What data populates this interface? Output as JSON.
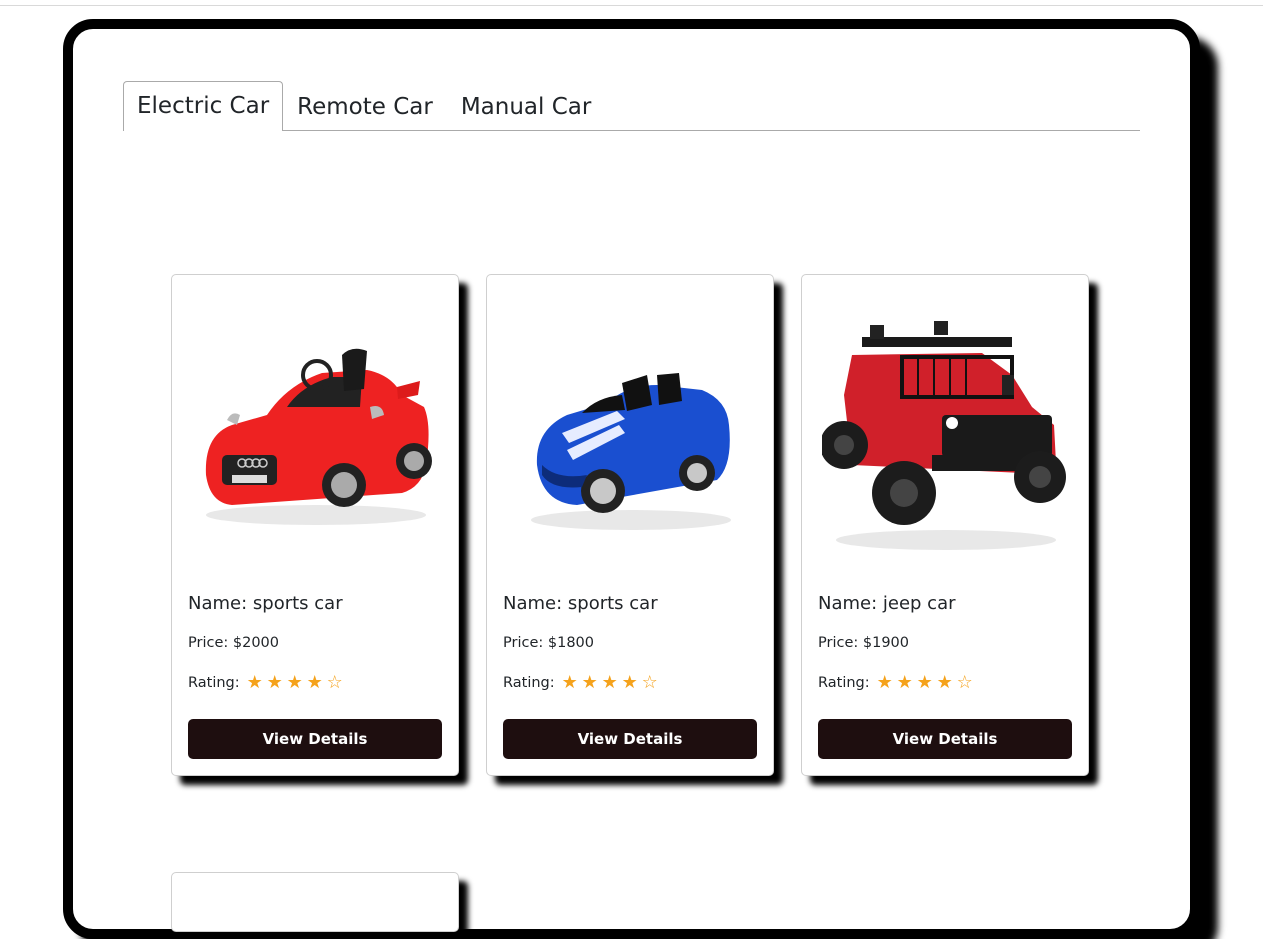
{
  "tabs": [
    {
      "label": "Electric Car",
      "active": true
    },
    {
      "label": "Remote Car",
      "active": false
    },
    {
      "label": "Manual Car",
      "active": false
    }
  ],
  "cards": [
    {
      "name": "Name: sports car",
      "price": "Price: $2000",
      "rating_label": "Rating:",
      "rating": 4,
      "max_rating": 5,
      "button": "View Details",
      "image": "red-audi-toy-car"
    },
    {
      "name": "Name: sports car",
      "price": "Price: $1800",
      "rating_label": "Rating:",
      "rating": 4,
      "max_rating": 5,
      "button": "View Details",
      "image": "blue-sports-toy-car"
    },
    {
      "name": "Name: jeep car",
      "price": "Price: $1900",
      "rating_label": "Rating:",
      "rating": 4,
      "max_rating": 5,
      "button": "View Details",
      "image": "red-jeep-toy-car"
    }
  ],
  "colors": {
    "button_bg": "#1e0e0f",
    "star": "#f5a21b",
    "frame": "#000000"
  }
}
